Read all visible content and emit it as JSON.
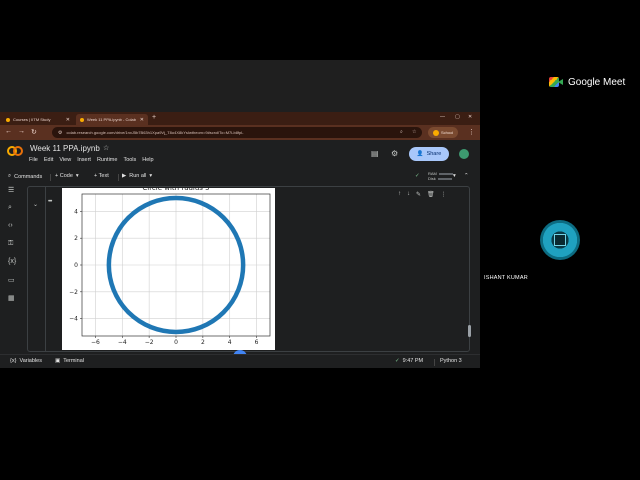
{
  "meet": {
    "brand": "Google Meet",
    "participant_name": "ISHANT KUMAR"
  },
  "browser": {
    "tabs": [
      {
        "label": "Courses | IITM Study"
      },
      {
        "label": "Week 11 PPA.ipynb - Colab"
      }
    ],
    "new_tab": "+",
    "url": "colab.research.google.com/drive/1nxJ5b7B63h1Xpa9Vj_T8o4X8kYsIwtheom=9#scrollTo=M7Lb8fpL",
    "profile_label": "School"
  },
  "colab": {
    "title": "Week 11 PPA.ipynb",
    "menu": [
      "File",
      "Edit",
      "View",
      "Insert",
      "Runtime",
      "Tools",
      "Help"
    ],
    "share_label": "Share",
    "toolbar": {
      "commands": "Commands",
      "code": "+ Code",
      "text": "+ Text",
      "run_all": "Run all"
    },
    "ram_label": "RAM",
    "disk_label": "Disk",
    "status": {
      "variables": "Variables",
      "terminal": "Terminal",
      "time": "9:47 PM",
      "kernel": "Python 3"
    }
  },
  "chart_data": {
    "type": "line",
    "title": "Circle with radius 5",
    "series": [
      {
        "shape": "circle",
        "center": [
          0,
          0
        ],
        "radius": 5,
        "color": "#1f77b4"
      }
    ],
    "xlim": [
      -7,
      7
    ],
    "ylim": [
      -5.3,
      5.3
    ],
    "xticks": [
      -6,
      -4,
      -2,
      0,
      2,
      4,
      6
    ],
    "yticks": [
      -4,
      -2,
      0,
      2,
      4
    ],
    "grid": true,
    "xlabel": "",
    "ylabel": ""
  }
}
